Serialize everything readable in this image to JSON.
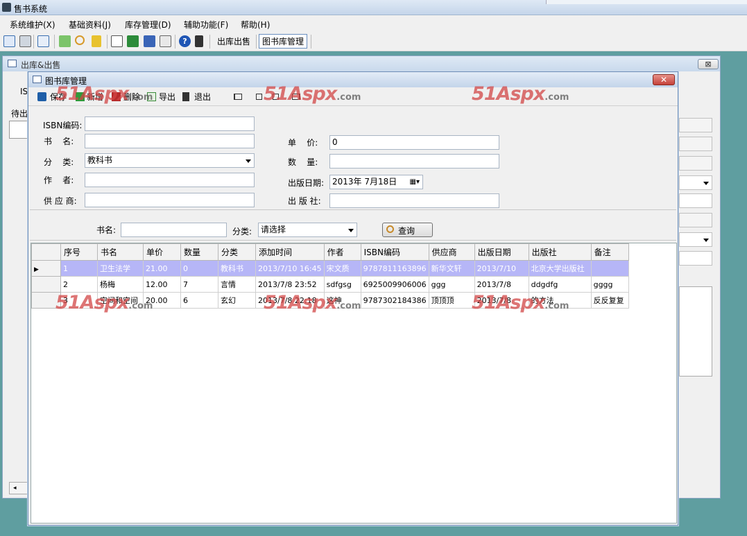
{
  "app": {
    "title": "售书系统"
  },
  "menu": [
    "系统维护(X)",
    "基础资料(J)",
    "库存管理(D)",
    "辅助功能(F)",
    "帮助(H)"
  ],
  "toolbar": {
    "sell_label": "出库出售",
    "library_label": "图书库管理"
  },
  "bg_window": {
    "title": "出库&出售",
    "partial_isbn": "IS",
    "partial_pending": "待出",
    "close_label": "⊠"
  },
  "front_window": {
    "title": "图书库管理",
    "close_label": "✕",
    "tools": {
      "save": "保存",
      "add": "新增",
      "delete": "删除",
      "export": "导出",
      "exit": "退出"
    },
    "form": {
      "isbn_label": "ISBN编码:",
      "name_label": "书    名:",
      "category_label": "分    类:",
      "category_value": "教科书",
      "author_label": "作    者:",
      "supplier_label": "供 应 商:",
      "price_label": "单    价:",
      "price_value": "0",
      "quantity_label": "数    量:",
      "pubdate_label": "出版日期:",
      "pubdate_value": "2013年 7月18日",
      "publisher_label": "出 版 社:"
    },
    "search": {
      "name_label": "书名:",
      "category_label": "分类:",
      "category_value": "请选择",
      "button_label": "查询"
    },
    "grid": {
      "columns": [
        "序号",
        "书名",
        "单价",
        "数量",
        "分类",
        "添加时间",
        "作者",
        "ISBN编码",
        "供应商",
        "出版日期",
        "出版社",
        "备注"
      ],
      "rows": [
        [
          "1",
          "卫生法学",
          "21.00",
          "0",
          "教科书",
          "2013/7/10 16:45",
          "宋文质",
          "9787811163896",
          "新华文轩",
          "2013/7/10",
          "北京大学出版社",
          ""
        ],
        [
          "2",
          "杨梅",
          "12.00",
          "7",
          "言情",
          "2013/7/8 23:52",
          "sdfgsg",
          "6925009906006",
          "ggg",
          "2013/7/8",
          "ddgdfg",
          "gggg"
        ],
        [
          "3",
          "空间和空间",
          "20.00",
          "6",
          "玄幻",
          "2013/7/8 22:18",
          "这神",
          "9787302184386",
          "顶顶顶",
          "2013/7/8",
          "的方法",
          "反反复复"
        ]
      ]
    }
  },
  "watermark": {
    "main": "51Aspx",
    "suffix": ".com"
  },
  "colors": {
    "desktop": "#5f9ea0",
    "selected_row": "#b6b6f7",
    "watermark": "#d24646"
  }
}
